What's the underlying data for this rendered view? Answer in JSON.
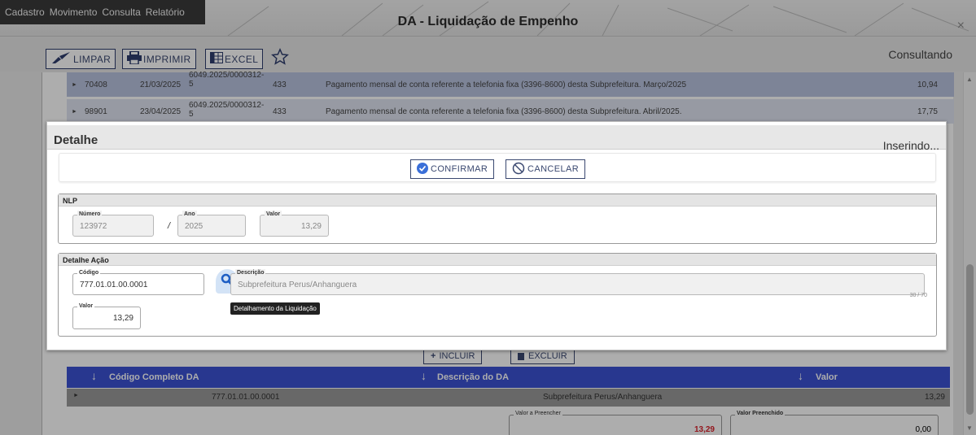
{
  "menu": [
    "Cadastro",
    "Movimento",
    "Consulta",
    "Relatório"
  ],
  "window": {
    "title": "DA - Liquidação de Empenho",
    "close_glyph": "×"
  },
  "toolbar": {
    "limpar": "LIMPAR",
    "imprimir": "IMPRIMIR",
    "excel": "EXCEL",
    "status": "Consultando"
  },
  "background_rows": [
    {
      "id": "70408",
      "date": "21/03/2025",
      "process": "6049.2025/0000312-5",
      "code": "433",
      "description": "Pagamento mensal de conta referente a telefonia fixa (3396-8600) desta Subprefeitura. Março/2025",
      "value": "10,94"
    },
    {
      "id": "98901",
      "date": "23/04/2025",
      "process": "6049.2025/0000312-5",
      "code": "433",
      "description": "Pagamento mensal de conta referente a telefonia fixa (3396-8600) desta Subprefeitura. Abril/2025.",
      "value": "17,75"
    }
  ],
  "modal": {
    "title": "Detalhe",
    "status": "Inserindo...",
    "confirm_label": "CONFIRMAR",
    "cancel_label": "CANCELAR",
    "nlp": {
      "section_title": "NLP",
      "numero_label": "Número",
      "numero_value": "123972",
      "slash": "/",
      "ano_label": "Ano",
      "ano_value": "2025",
      "valor_label": "Valor",
      "valor_value": "13,29"
    },
    "detalhe_acao": {
      "section_title": "Detalhe Ação",
      "codigo_label": "Código",
      "codigo_value": "777.01.01.00.0001",
      "descricao_label": "Descrição",
      "descricao_value": "Subprefeitura Perus/Anhanguera",
      "counter": "30 / 70",
      "tooltip": "Detalhamento da Liquidação",
      "valor_label": "Valor",
      "valor_value": "13,29"
    }
  },
  "bottom": {
    "incluir": "INCLUIR",
    "excluir": "EXCLUIR",
    "headers": [
      "Código Completo DA",
      "Descrição do DA",
      "Valor"
    ],
    "row": {
      "codigo": "777.01.01.00.0001",
      "descricao": "Subprefeitura Perus/Anhanguera",
      "valor": "13,29"
    },
    "valor_a_preencher_label": "Valor a Preencher",
    "valor_a_preencher_value": "13,29",
    "valor_preenchido_label": "Valor Preenchido",
    "valor_preenchido_value": "0,00"
  },
  "colors": {
    "accent": "#2e3d6e",
    "grid_header": "#3b52d3",
    "confirm_icon": "#3a6fd8",
    "search_icon": "#1f5fc4",
    "negative_value": "#d9232d"
  },
  "icons": [
    "brush-icon",
    "printer-icon",
    "spreadsheet-icon",
    "star-icon",
    "check-circle-icon",
    "cancel-circle-icon",
    "search-icon",
    "arrow-down-icon"
  ]
}
